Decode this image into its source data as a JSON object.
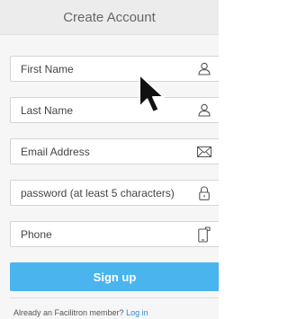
{
  "header": {
    "title": "Create Account"
  },
  "fields": [
    {
      "label": "First Name",
      "icon": "user-icon"
    },
    {
      "label": "Last Name",
      "icon": "user-icon"
    },
    {
      "label": "Email Address",
      "icon": "envelope-icon"
    },
    {
      "label": "password (at least 5 characters)",
      "icon": "lock-icon"
    },
    {
      "label": "Phone",
      "icon": "phone-icon"
    }
  ],
  "signup": {
    "label": "Sign up"
  },
  "footer": {
    "prompt": "Already an Facilitron member?",
    "link": "Log in"
  },
  "colors": {
    "accent": "#4ab4ef",
    "link": "#2b8fd6"
  }
}
